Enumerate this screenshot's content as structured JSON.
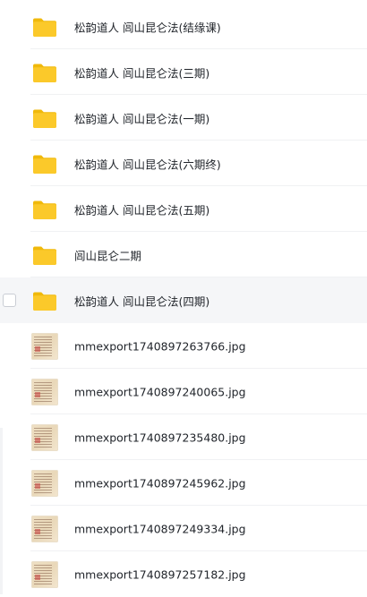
{
  "items": [
    {
      "type": "folder",
      "name": "松韵道人 闾山昆仑法(结缘课)",
      "icon": "folder-icon"
    },
    {
      "type": "folder",
      "name": "松韵道人 闾山昆仑法(三期)",
      "icon": "folder-icon"
    },
    {
      "type": "folder",
      "name": "松韵道人 闾山昆仑法(一期)",
      "icon": "folder-icon"
    },
    {
      "type": "folder",
      "name": "松韵道人 闾山昆仑法(六期终)",
      "icon": "folder-icon"
    },
    {
      "type": "folder",
      "name": "松韵道人 闾山昆仑法(五期)",
      "icon": "folder-icon"
    },
    {
      "type": "folder",
      "name": "闾山昆仑二期",
      "icon": "folder-icon"
    },
    {
      "type": "folder",
      "name": "松韵道人 闾山昆仑法(四期)",
      "icon": "folder-icon",
      "selected": true
    },
    {
      "type": "image",
      "name": "mmexport1740897263766.jpg",
      "icon": "image-thumbnail"
    },
    {
      "type": "image",
      "name": "mmexport1740897240065.jpg",
      "icon": "image-thumbnail"
    },
    {
      "type": "image",
      "name": "mmexport1740897235480.jpg",
      "icon": "image-thumbnail"
    },
    {
      "type": "image",
      "name": "mmexport1740897245962.jpg",
      "icon": "image-thumbnail"
    },
    {
      "type": "image",
      "name": "mmexport1740897249334.jpg",
      "icon": "image-thumbnail"
    },
    {
      "type": "image",
      "name": "mmexport1740897257182.jpg",
      "icon": "image-thumbnail"
    }
  ],
  "colors": {
    "folder": "#f5c518",
    "folder_back": "#f0b90b",
    "selected_row": "#f5f6f8",
    "text": "#1f2329"
  }
}
